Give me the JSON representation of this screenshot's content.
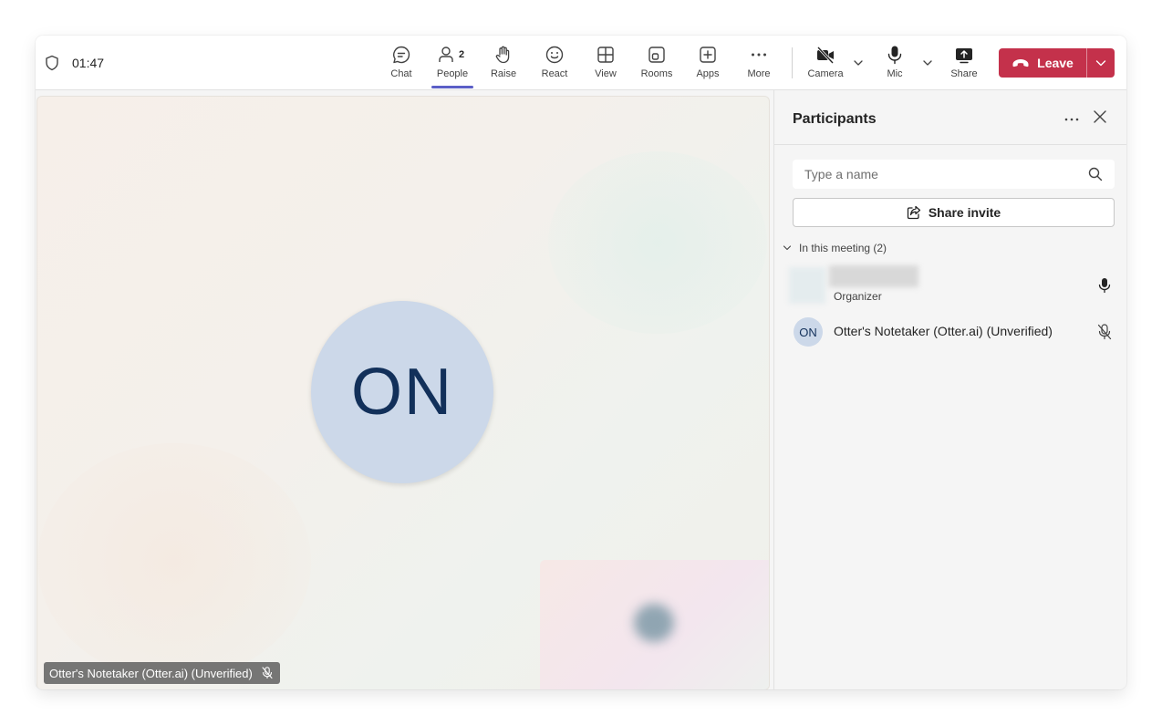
{
  "meeting": {
    "timer": "01:47"
  },
  "toolbar": {
    "chat": "Chat",
    "people": "People",
    "people_count": "2",
    "raise": "Raise",
    "react": "React",
    "view": "View",
    "rooms": "Rooms",
    "apps": "Apps",
    "more": "More",
    "camera": "Camera",
    "mic": "Mic",
    "share": "Share",
    "leave": "Leave"
  },
  "stage": {
    "avatar_initials": "ON",
    "name_tag": "Otter's Notetaker (Otter.ai) (Unverified)"
  },
  "panel": {
    "title": "Participants",
    "search_placeholder": "Type a name",
    "share_invite": "Share invite",
    "section": "In this meeting (2)",
    "participants": [
      {
        "name": "",
        "role": "Organizer",
        "mic": "on"
      },
      {
        "initials": "ON",
        "name": "Otter's Notetaker (Otter.ai) (Unverified)",
        "mic": "muted"
      }
    ]
  },
  "colors": {
    "leave": "#c4314b",
    "accent": "#5b5fc7",
    "avatar_bg": "#ccd8e9",
    "avatar_text": "#12305a"
  }
}
